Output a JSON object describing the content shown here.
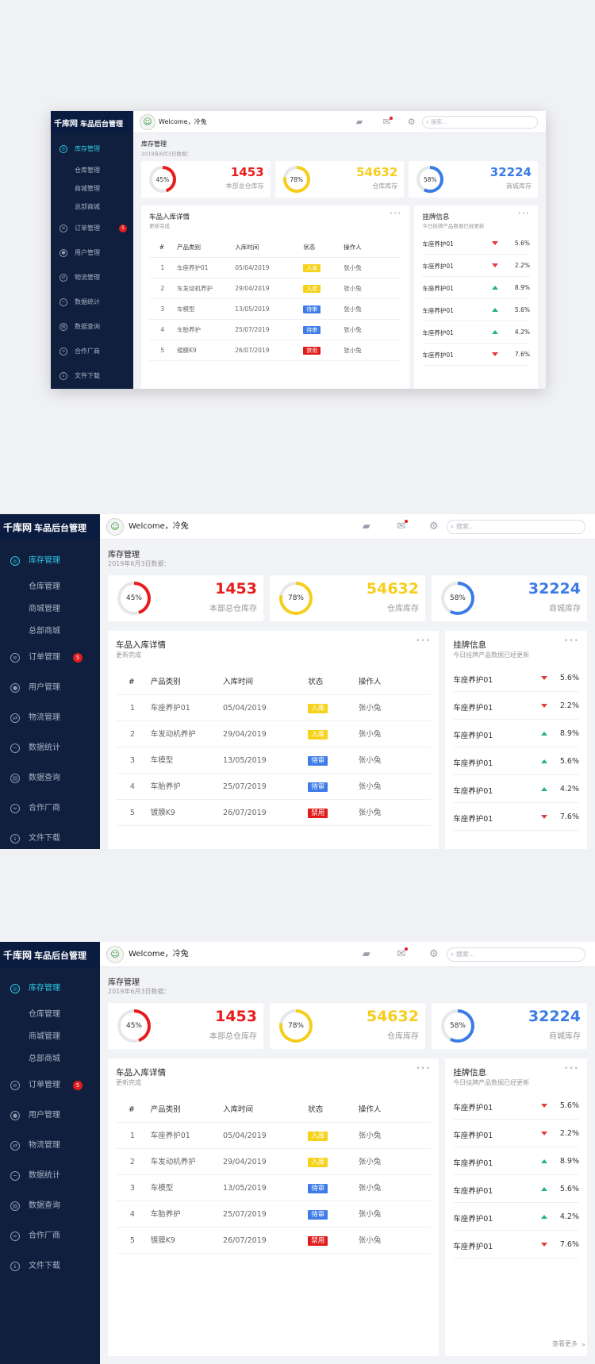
{
  "sidebar": {
    "brand": "千库网",
    "app_title": "车品后台管理",
    "items": [
      {
        "label": "库存管理",
        "icon": "inventory-icon",
        "glyph": "◎",
        "active": true
      },
      {
        "label": "仓库管理",
        "sub": true
      },
      {
        "label": "商城管理",
        "sub": true
      },
      {
        "label": "总部商城",
        "sub": true
      },
      {
        "label": "订单管理",
        "icon": "order-icon",
        "glyph": "≡",
        "badge": "5"
      },
      {
        "label": "用户管理",
        "icon": "user-icon",
        "glyph": "●"
      },
      {
        "label": "物流管理",
        "icon": "logistics-icon",
        "glyph": "⇄"
      },
      {
        "label": "数据统计",
        "icon": "chart-icon",
        "glyph": "~"
      },
      {
        "label": "数据查询",
        "icon": "query-icon",
        "glyph": "▤"
      },
      {
        "label": "合作厂商",
        "icon": "partner-icon",
        "glyph": "∞"
      },
      {
        "label": "文件下载",
        "icon": "download-icon",
        "glyph": "↓"
      }
    ]
  },
  "topbar": {
    "welcome": "Welcome，冷兔",
    "search_placeholder": "搜索..."
  },
  "page": {
    "title": "库存管理",
    "date": "2019年6月3日数据："
  },
  "stats": [
    {
      "percent": "45%",
      "progress": 0.45,
      "value": "1453",
      "label": "本部总仓库存",
      "color": "#e81c1c"
    },
    {
      "percent": "78%",
      "progress": 0.78,
      "value": "54632",
      "label": "仓库库存",
      "color": "#f7cd1b"
    },
    {
      "percent": "58%",
      "progress": 0.58,
      "value": "32224",
      "label": "商城库存",
      "color": "#3a7ce6"
    }
  ],
  "inbound": {
    "title": "车品入库详情",
    "subtitle": "更新完成",
    "columns": [
      "#",
      "产品类别",
      "入库时间",
      "状态",
      "操作人"
    ],
    "rows": [
      {
        "no": "1",
        "category": "车座养护01",
        "date": "05/04/2019",
        "status": "入库",
        "status_type": "in",
        "operator": "张小兔"
      },
      {
        "no": "2",
        "category": "车发动机养护",
        "date": "29/04/2019",
        "status": "入库",
        "status_type": "in",
        "operator": "张小兔"
      },
      {
        "no": "3",
        "category": "车模型",
        "date": "13/05/2019",
        "status": "待审",
        "status_type": "wait",
        "operator": "张小兔"
      },
      {
        "no": "4",
        "category": "车胎养护",
        "date": "25/07/2019",
        "status": "待审",
        "status_type": "wait",
        "operator": "张小兔"
      },
      {
        "no": "5",
        "category": "镀膜K9",
        "date": "26/07/2019",
        "status": "禁用",
        "status_type": "ban",
        "operator": "张小兔"
      }
    ]
  },
  "listing": {
    "title": "挂牌信息",
    "subtitle": "今日挂牌产品数据已经更新",
    "more": "查看更多",
    "rows": [
      {
        "name": "车座养护01",
        "trend": "down",
        "value": "5.6%"
      },
      {
        "name": "车座养护01",
        "trend": "down",
        "value": "2.2%"
      },
      {
        "name": "车座养护01",
        "trend": "up",
        "value": "8.9%"
      },
      {
        "name": "车座养护01",
        "trend": "up",
        "value": "5.6%"
      },
      {
        "name": "车座养护01",
        "trend": "up",
        "value": "4.2%"
      },
      {
        "name": "车座养护01",
        "trend": "down",
        "value": "7.6%"
      }
    ]
  }
}
